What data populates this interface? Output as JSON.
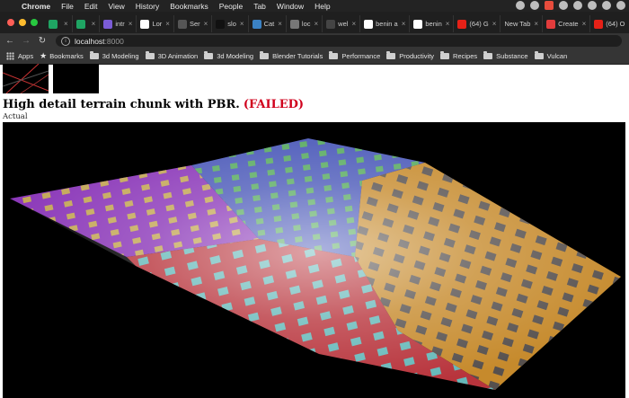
{
  "menubar": {
    "app": "Chrome",
    "items": [
      "File",
      "Edit",
      "View",
      "History",
      "Bookmarks",
      "People",
      "Tab",
      "Window",
      "Help"
    ]
  },
  "tabs": [
    {
      "label": "",
      "icon": "sheets-icon",
      "color": "#1fa463"
    },
    {
      "label": "",
      "icon": "sheets-icon",
      "color": "#1fa463"
    },
    {
      "label": "intr",
      "icon": "app-icon",
      "color": "#7b5cd6"
    },
    {
      "label": "Lor",
      "icon": "wiki-icon",
      "color": "#ffffff"
    },
    {
      "label": "Ser",
      "icon": "page-icon",
      "color": "#555555"
    },
    {
      "label": "slo",
      "icon": "github-icon",
      "color": "#111111"
    },
    {
      "label": "Cat",
      "icon": "docs-icon",
      "color": "#3b82c4"
    },
    {
      "label": "loc",
      "icon": "globe-icon",
      "color": "#777777"
    },
    {
      "label": "wel",
      "icon": "page-icon",
      "color": "#444444"
    },
    {
      "label": "benin a",
      "icon": "google-icon",
      "color": "#ffffff"
    },
    {
      "label": "benin",
      "icon": "google-icon",
      "color": "#ffffff"
    },
    {
      "label": "(64) G",
      "icon": "youtube-icon",
      "color": "#e62117"
    },
    {
      "label": "New Tab",
      "icon": "",
      "color": ""
    },
    {
      "label": "Create",
      "icon": "app-icon",
      "color": "#e23c3c"
    },
    {
      "label": "(64) O",
      "icon": "youtube-icon",
      "color": "#e62117"
    }
  ],
  "url": {
    "host": "localhost",
    "port": ":8000"
  },
  "bookmarks": [
    {
      "label": "Apps",
      "icon": "apps-icon"
    },
    {
      "label": "Bookmarks",
      "icon": "star-icon"
    },
    {
      "label": "3d Modeling",
      "icon": "folder-icon"
    },
    {
      "label": "3D Animation",
      "icon": "folder-icon"
    },
    {
      "label": "3d Modeling",
      "icon": "folder-icon"
    },
    {
      "label": "Blender Tutorials",
      "icon": "folder-icon"
    },
    {
      "label": "Performance",
      "icon": "folder-icon"
    },
    {
      "label": "Productivity",
      "icon": "folder-icon"
    },
    {
      "label": "Recipes",
      "icon": "folder-icon"
    },
    {
      "label": "Substance",
      "icon": "folder-icon"
    },
    {
      "label": "Vulcan",
      "icon": "folder-icon"
    }
  ],
  "page": {
    "title": "High detail terrain chunk with PBR.",
    "status": "(FAILED)",
    "status_color": "#d0001c",
    "view_label": "Actual"
  },
  "terrain_colors": {
    "purple": "#8a36b8",
    "red": "#b8343c",
    "orange": "#c68a2c",
    "blue": "#4a58b8",
    "patch_cyan": "#5cc7c7",
    "patch_yellow": "#c9b24a",
    "patch_green": "#5bbf4a",
    "patch_gray": "#4a4a52"
  }
}
